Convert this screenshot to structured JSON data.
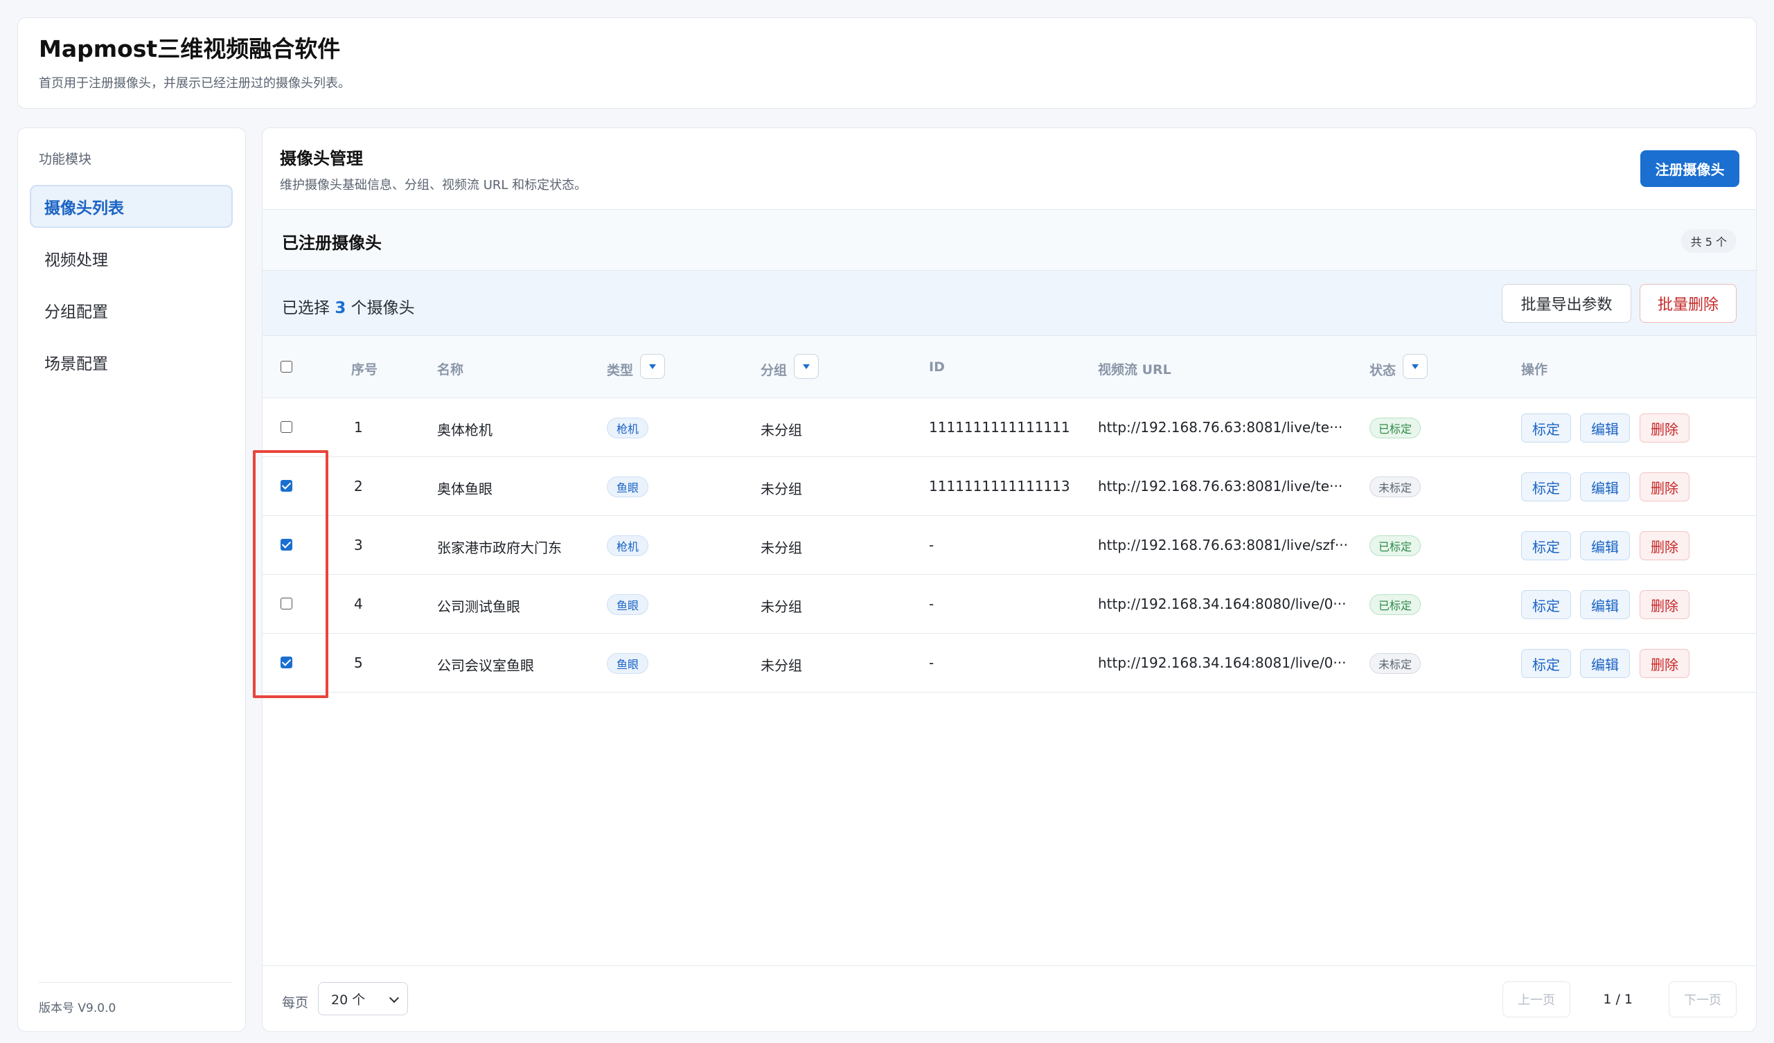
{
  "app": {
    "title": "Mapmost三维视频融合软件",
    "subtitle": "首页用于注册摄像头，并展示已经注册过的摄像头列表。"
  },
  "sidebar": {
    "section_title": "功能模块",
    "items": [
      {
        "label": "摄像头列表",
        "active": true
      },
      {
        "label": "视频处理",
        "active": false
      },
      {
        "label": "分组配置",
        "active": false
      },
      {
        "label": "场景配置",
        "active": false
      }
    ],
    "version": "版本号 V9.0.0"
  },
  "panel": {
    "title": "摄像头管理",
    "description": "维护摄像头基础信息、分组、视频流 URL 和标定状态。",
    "register_button": "注册摄像头"
  },
  "list": {
    "title": "已注册摄像头",
    "count_badge": "共 5 个"
  },
  "selection": {
    "prefix": "已选择",
    "count": "3",
    "suffix": "个摄像头",
    "export_button": "批量导出参数",
    "delete_button": "批量删除"
  },
  "table": {
    "headers": {
      "index": "序号",
      "name": "名称",
      "type": "类型",
      "group": "分组",
      "id": "ID",
      "url": "视频流 URL",
      "status": "状态",
      "actions": "操作"
    },
    "action_labels": {
      "calibrate": "标定",
      "edit": "编辑",
      "delete": "删除"
    },
    "rows": [
      {
        "checked": false,
        "index": "1",
        "name": "奥体枪机",
        "type": "枪机",
        "group": "未分组",
        "id": "1111111111111111",
        "url": "http://192.168.76.63:8081/live/te···",
        "status": "已标定",
        "calibrated": true
      },
      {
        "checked": true,
        "index": "2",
        "name": "奥体鱼眼",
        "type": "鱼眼",
        "group": "未分组",
        "id": "1111111111111113",
        "url": "http://192.168.76.63:8081/live/te···",
        "status": "未标定",
        "calibrated": false
      },
      {
        "checked": true,
        "index": "3",
        "name": "张家港市政府大门东",
        "type": "枪机",
        "group": "未分组",
        "id": "-",
        "url": "http://192.168.76.63:8081/live/szf···",
        "status": "已标定",
        "calibrated": true
      },
      {
        "checked": false,
        "index": "4",
        "name": "公司测试鱼眼",
        "type": "鱼眼",
        "group": "未分组",
        "id": "-",
        "url": "http://192.168.34.164:8080/live/0···",
        "status": "已标定",
        "calibrated": true
      },
      {
        "checked": true,
        "index": "5",
        "name": "公司会议室鱼眼",
        "type": "鱼眼",
        "group": "未分组",
        "id": "-",
        "url": "http://192.168.34.164:8081/live/0···",
        "status": "未标定",
        "calibrated": false
      }
    ]
  },
  "pagination": {
    "per_page_label": "每页",
    "per_page_value": "20 个",
    "prev": "上一页",
    "info": "1 / 1",
    "next": "下一页"
  },
  "colors": {
    "primary": "#1a6fd0",
    "danger": "#c62828",
    "success": "#2e8a49",
    "highlight": "#e8453c"
  }
}
